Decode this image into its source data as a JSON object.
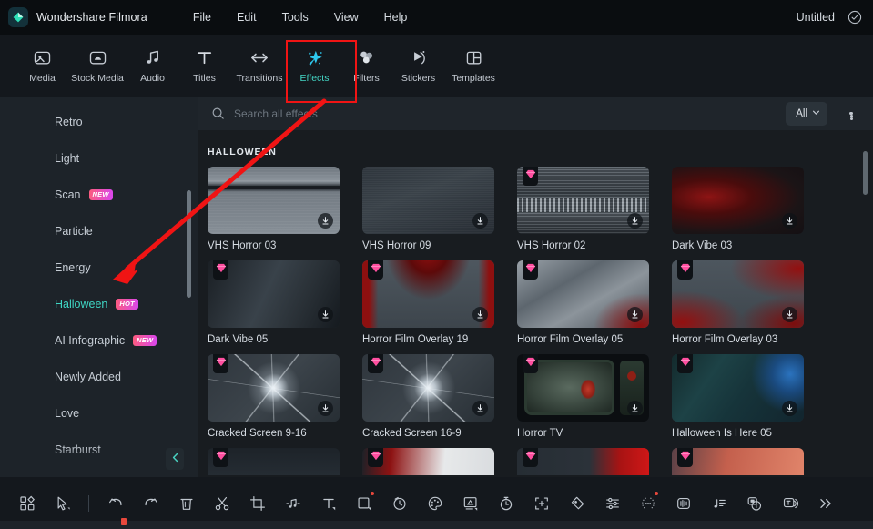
{
  "titlebar": {
    "logo_icon": "filmora-diamond-logo",
    "app_name": "Wondershare Filmora",
    "menus": [
      "File",
      "Edit",
      "Tools",
      "View",
      "Help"
    ],
    "project_name": "Untitled",
    "status_icon": "check-circle-icon"
  },
  "tooltabs": {
    "items": [
      {
        "label": "Media",
        "icon": "media-icon",
        "active": false
      },
      {
        "label": "Stock Media",
        "icon": "stock-media-icon",
        "active": false
      },
      {
        "label": "Audio",
        "icon": "audio-note-icon",
        "active": false
      },
      {
        "label": "Titles",
        "icon": "titles-text-icon",
        "active": false
      },
      {
        "label": "Transitions",
        "icon": "transitions-arrow-icon",
        "active": false
      },
      {
        "label": "Effects",
        "icon": "effects-sparkle-icon",
        "active": true
      },
      {
        "label": "Filters",
        "icon": "filters-circles-icon",
        "active": false
      },
      {
        "label": "Stickers",
        "icon": "stickers-icon",
        "active": false
      },
      {
        "label": "Templates",
        "icon": "templates-grid-icon",
        "active": false
      }
    ],
    "active_label": "Effects",
    "highlight_color": "#f01414",
    "accent_color": "#44d7c6"
  },
  "sidebar": {
    "items": [
      {
        "label": "Retro",
        "badge": "",
        "active": false
      },
      {
        "label": "Light",
        "badge": "",
        "active": false
      },
      {
        "label": "Scan",
        "badge": "NEW",
        "active": false
      },
      {
        "label": "Particle",
        "badge": "",
        "active": false
      },
      {
        "label": "Energy",
        "badge": "",
        "active": false
      },
      {
        "label": "Halloween",
        "badge": "HOT",
        "active": true
      },
      {
        "label": "AI Infographic",
        "badge": "NEW",
        "active": false
      },
      {
        "label": "Newly Added",
        "badge": "",
        "active": false
      },
      {
        "label": "Love",
        "badge": "",
        "active": false
      },
      {
        "label": "Starburst",
        "badge": "",
        "active": false
      }
    ],
    "collapse_icon": "chevron-left-icon"
  },
  "search": {
    "placeholder": "Search all effects",
    "value": "",
    "icon": "search-icon"
  },
  "filter": {
    "selected": "All",
    "chevron_icon": "chevron-down-icon",
    "more_icon": "more-options-icon"
  },
  "effects": {
    "section_title": "HALLOWEEN",
    "cards": [
      {
        "name": "VHS Horror 03",
        "pro": false,
        "download": true,
        "art": "vhs1"
      },
      {
        "name": "VHS Horror 09",
        "pro": false,
        "download": true,
        "art": "vhs9"
      },
      {
        "name": "VHS Horror 02",
        "pro": true,
        "download": true,
        "art": "vhs2"
      },
      {
        "name": "Dark Vibe 03",
        "pro": false,
        "download": true,
        "art": "dark3"
      },
      {
        "name": "Dark Vibe 05",
        "pro": true,
        "download": true,
        "art": "dark5"
      },
      {
        "name": "Horror Film Overlay 19",
        "pro": true,
        "download": true,
        "art": "hfo19"
      },
      {
        "name": "Horror Film Overlay 05",
        "pro": true,
        "download": true,
        "art": "hfo05"
      },
      {
        "name": "Horror Film Overlay 03",
        "pro": true,
        "download": true,
        "art": "hfo03"
      },
      {
        "name": "Cracked Screen 9-16",
        "pro": true,
        "download": true,
        "art": "crack"
      },
      {
        "name": "Cracked Screen 16-9",
        "pro": true,
        "download": true,
        "art": "crack"
      },
      {
        "name": "Horror TV",
        "pro": true,
        "download": true,
        "art": "tv"
      },
      {
        "name": "Halloween Is Here 05",
        "pro": true,
        "download": true,
        "art": "hih"
      }
    ],
    "partial_row": [
      {
        "pro": true,
        "art": "p1"
      },
      {
        "pro": true,
        "art": "p2"
      },
      {
        "pro": true,
        "art": "p3"
      },
      {
        "pro": true,
        "art": "p4"
      }
    ],
    "pro_badge_icon": "pro-gem-icon",
    "download_icon": "download-icon"
  },
  "bottom_toolbar": {
    "tools": [
      {
        "icon": "layout-grid-icon",
        "badge": false
      },
      {
        "icon": "selection-cursor-icon",
        "badge": false
      },
      {
        "icon": "separator",
        "badge": false
      },
      {
        "icon": "undo-icon",
        "badge": false
      },
      {
        "icon": "redo-icon",
        "badge": false
      },
      {
        "icon": "delete-trash-icon",
        "badge": false
      },
      {
        "icon": "split-scissors-icon",
        "badge": false
      },
      {
        "icon": "crop-icon",
        "badge": false
      },
      {
        "icon": "audio-detach-icon",
        "badge": false
      },
      {
        "icon": "text-tool-icon",
        "badge": false
      },
      {
        "icon": "shape-mask-icon",
        "badge": true
      },
      {
        "icon": "speed-ramp-icon",
        "badge": false
      },
      {
        "icon": "color-palette-icon",
        "badge": false
      },
      {
        "icon": "green-screen-icon",
        "badge": false
      },
      {
        "icon": "stopwatch-icon",
        "badge": false
      },
      {
        "icon": "auto-reframe-icon",
        "badge": false
      },
      {
        "icon": "keyframe-icon",
        "badge": false
      },
      {
        "icon": "adjust-sliders-icon",
        "badge": false
      },
      {
        "icon": "smart-cutout-icon",
        "badge": true
      },
      {
        "icon": "audio-wave-icon",
        "badge": false
      },
      {
        "icon": "beat-detect-icon",
        "badge": false
      },
      {
        "icon": "speech-to-text-icon",
        "badge": false
      },
      {
        "icon": "text-to-speech-icon",
        "badge": false
      },
      {
        "icon": "more-chevrons-icon",
        "badge": false
      }
    ]
  },
  "annotation": {
    "arrow_color": "#f01414",
    "arrow_from": "Effects tab",
    "arrow_to": "Halloween category"
  }
}
